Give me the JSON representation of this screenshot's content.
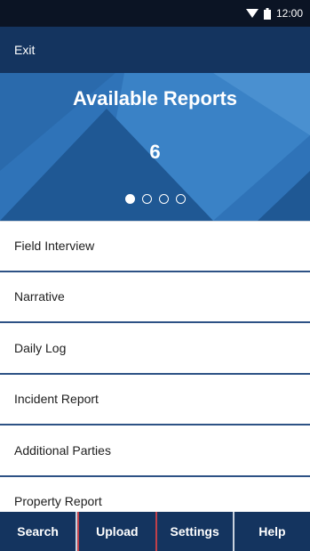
{
  "status_bar": {
    "time": "12:00",
    "icons": [
      "wifi-icon",
      "battery-icon"
    ]
  },
  "toolbar": {
    "exit_label": "Exit"
  },
  "hero": {
    "title": "Available Reports",
    "count": "6",
    "pager": {
      "total": 4,
      "active_index": 0
    }
  },
  "reports": [
    {
      "label": "Field Interview"
    },
    {
      "label": "Narrative"
    },
    {
      "label": "Daily Log"
    },
    {
      "label": "Incident Report"
    },
    {
      "label": "Additional Parties"
    },
    {
      "label": "Property Report"
    }
  ],
  "bottom_nav": {
    "search_label": "Search",
    "upload_label": "Upload",
    "settings_label": "Settings",
    "help_label": "Help"
  },
  "colors": {
    "status_bar": "#0b1424",
    "header": "#14345f",
    "hero": "#2f73b8",
    "divider": "#2d5285",
    "upload_border": "#c0404a"
  }
}
